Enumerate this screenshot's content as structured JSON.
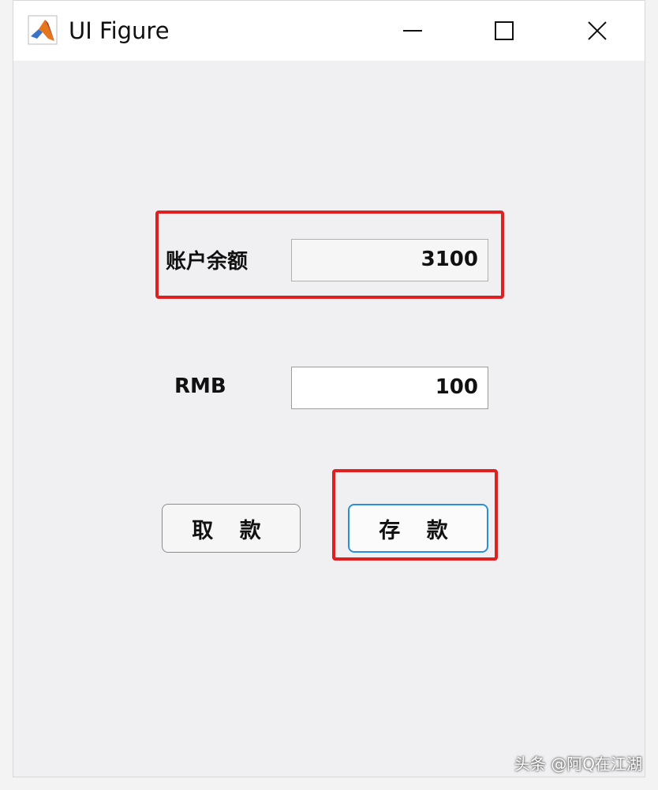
{
  "window": {
    "title": "UI Figure",
    "icon": "matlab-logo-icon",
    "controls": {
      "minimize": "minimize-icon",
      "maximize": "maximize-icon",
      "close": "close-icon"
    }
  },
  "form": {
    "balance_label": "账户余额",
    "balance_value": "3100",
    "rmb_label": "RMB",
    "rmb_value": "100",
    "withdraw_label": "取 款",
    "deposit_label": "存 款"
  },
  "highlight_color": "#e02020",
  "focus_color": "#2a8fd8",
  "watermark": "头条 @阿Q在江湖"
}
